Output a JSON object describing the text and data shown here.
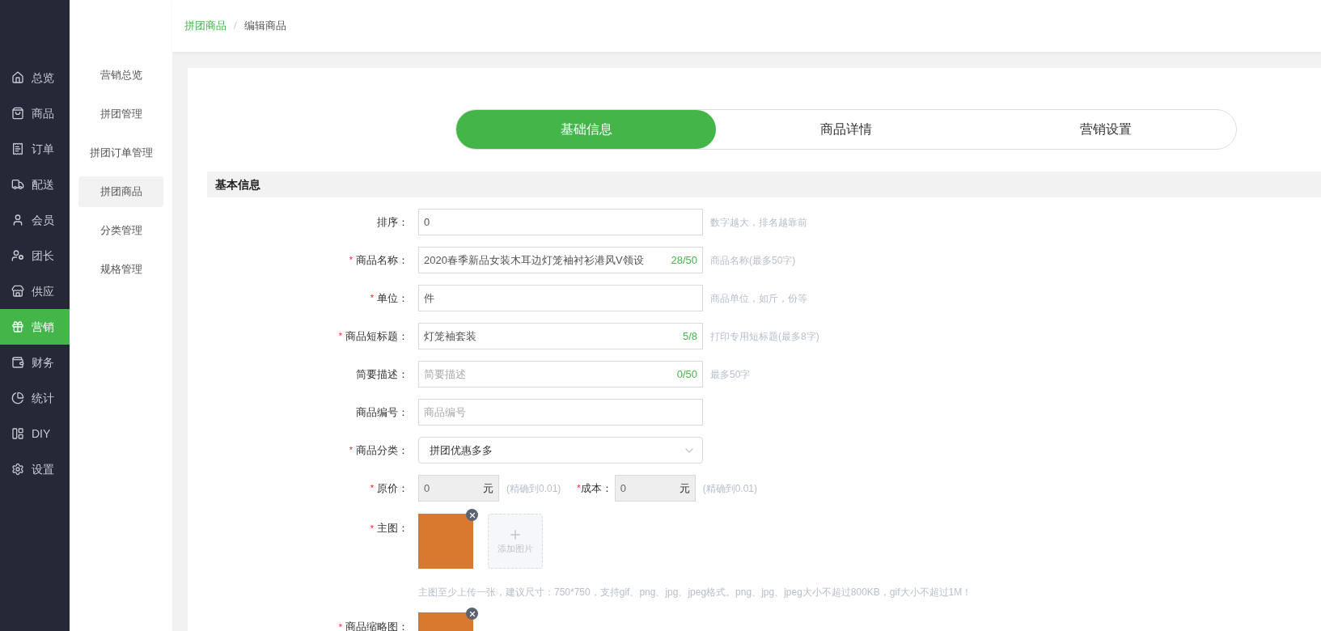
{
  "main_nav": [
    {
      "label": "总览",
      "selected": false
    },
    {
      "label": "商品",
      "selected": false
    },
    {
      "label": "订单",
      "selected": false
    },
    {
      "label": "配送",
      "selected": false
    },
    {
      "label": "会员",
      "selected": false
    },
    {
      "label": "团长",
      "selected": false
    },
    {
      "label": "供应",
      "selected": false
    },
    {
      "label": "营销",
      "selected": true
    },
    {
      "label": "财务",
      "selected": false
    },
    {
      "label": "统计",
      "selected": false
    },
    {
      "label": "DIY",
      "selected": false
    },
    {
      "label": "设置",
      "selected": false
    }
  ],
  "sub_nav": [
    {
      "label": "营销总览",
      "selected": false
    },
    {
      "label": "拼团管理",
      "selected": false
    },
    {
      "label": "拼团订单管理",
      "selected": false
    },
    {
      "label": "拼团商品",
      "selected": true
    },
    {
      "label": "分类管理",
      "selected": false
    },
    {
      "label": "规格管理",
      "selected": false
    }
  ],
  "breadcrumb": [
    {
      "label": "拼团商品",
      "kind": "link"
    },
    {
      "label": "/",
      "kind": "separator"
    },
    {
      "label": "编辑商品",
      "kind": "current"
    }
  ],
  "tabs": [
    {
      "label": "基础信息",
      "selected": true
    },
    {
      "label": "商品详情",
      "selected": false
    },
    {
      "label": "营销设置",
      "selected": false
    }
  ],
  "section_title": "基本信息",
  "fields": [
    {
      "kind": "text",
      "label": "排序：",
      "value": "0",
      "hint": "数字越大，排名越靠前"
    },
    {
      "kind": "text",
      "label": "商品名称：",
      "required_mark": "*",
      "value": "2020春季新品女装木耳边灯笼袖衬衫港风V领设",
      "counter": "28/50",
      "hint": "商品名称(最多50字)"
    },
    {
      "kind": "text",
      "label": "单位：",
      "required_mark": "*",
      "value": "件",
      "hint": "商品单位，如斤，份等"
    },
    {
      "kind": "text",
      "label": "商品短标题：",
      "required_mark": "*",
      "value": "灯笼袖套装",
      "counter": "5/8",
      "hint": "打印专用短标题(最多8字)"
    },
    {
      "kind": "text",
      "label": "简要描述：",
      "placeholder": "简要描述",
      "counter": "0/50",
      "hint": "最多50字"
    },
    {
      "kind": "text",
      "label": "商品编号：",
      "placeholder": "商品编号"
    },
    {
      "kind": "select",
      "label": "商品分类：",
      "required_mark": "*",
      "value": "拼团优惠多多"
    },
    {
      "kind": "price",
      "label": "原价：",
      "required_mark": "*",
      "value": "0",
      "unit": "元",
      "hint": "(精确到0.01)",
      "second": {
        "label": "成本：",
        "required_mark": "*",
        "value": "0",
        "unit": "元",
        "hint": "(精确到0.01)"
      }
    },
    {
      "kind": "images",
      "label": "主图：",
      "required_mark": "*",
      "add_label": "添加图片",
      "note": "主图至少上传一张，建议尺寸：750*750，支持gif、png、jpg、jpeg格式。png、jpg、jpeg大小不超过800KB，gif大小不超过1M！"
    },
    {
      "kind": "images",
      "label": "商品缩略图：",
      "required_mark": "*"
    }
  ]
}
